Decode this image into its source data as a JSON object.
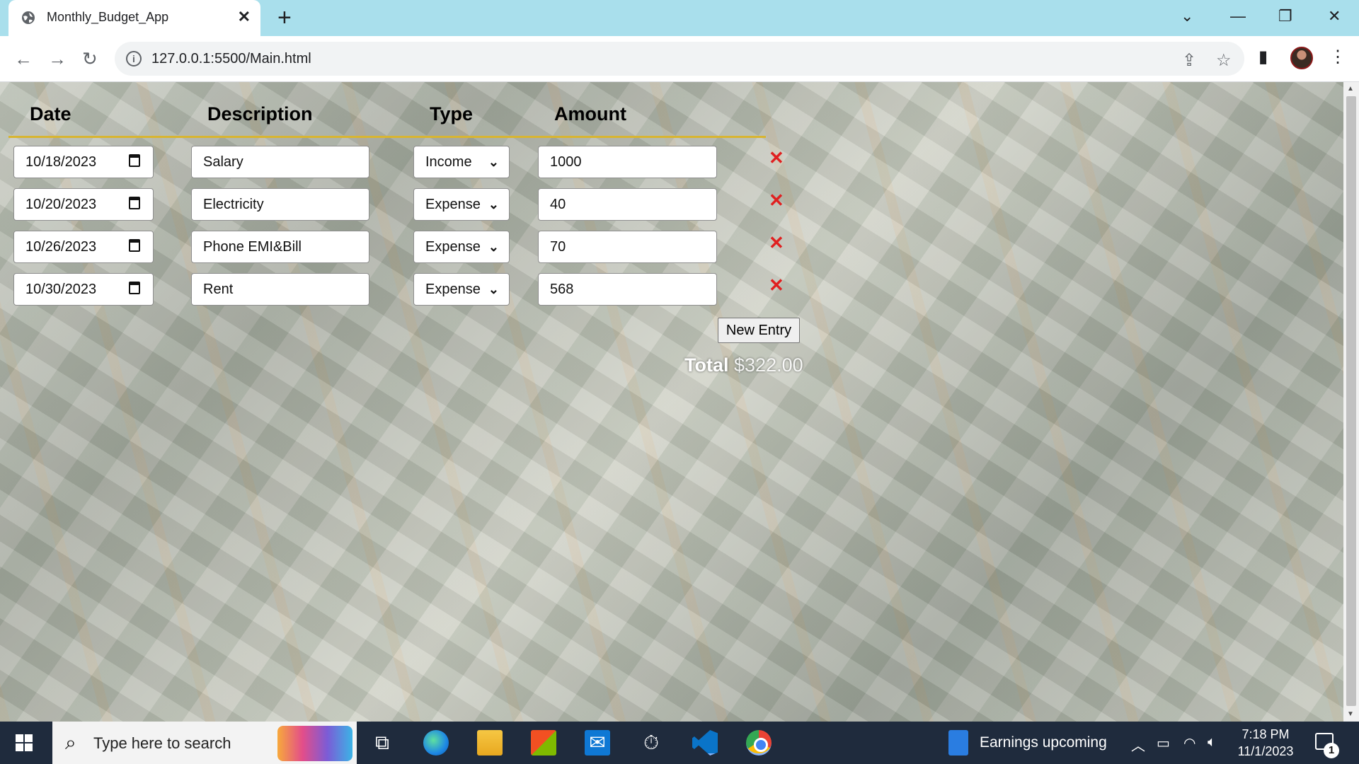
{
  "browser": {
    "tab_title": "Monthly_Budget_App",
    "url": "127.0.0.1:5500/Main.html"
  },
  "table": {
    "headers": {
      "date": "Date",
      "description": "Description",
      "type": "Type",
      "amount": "Amount"
    },
    "entries": [
      {
        "date": "10/18/2023",
        "description": "Salary",
        "type": "Income",
        "amount": "1000"
      },
      {
        "date": "10/20/2023",
        "description": "Electricity",
        "type": "Expense",
        "amount": "40"
      },
      {
        "date": "10/26/2023",
        "description": "Phone EMI&Bill",
        "type": "Expense",
        "amount": "70"
      },
      {
        "date": "10/30/2023",
        "description": "Rent",
        "type": "Expense",
        "amount": "568"
      }
    ],
    "delete_glyph": "✕",
    "new_entry_label": "New Entry",
    "total_label": "Total",
    "total_value": "$322.00"
  },
  "taskbar": {
    "search_placeholder": "Type here to search",
    "widget_text": "Earnings upcoming",
    "time": "7:18 PM",
    "date": "11/1/2023",
    "notification_count": "1"
  },
  "colors": {
    "tabbar": "#a9dfec",
    "header_rule": "#d8b531",
    "delete": "#e02020",
    "taskbar": "#1f2b3d"
  }
}
